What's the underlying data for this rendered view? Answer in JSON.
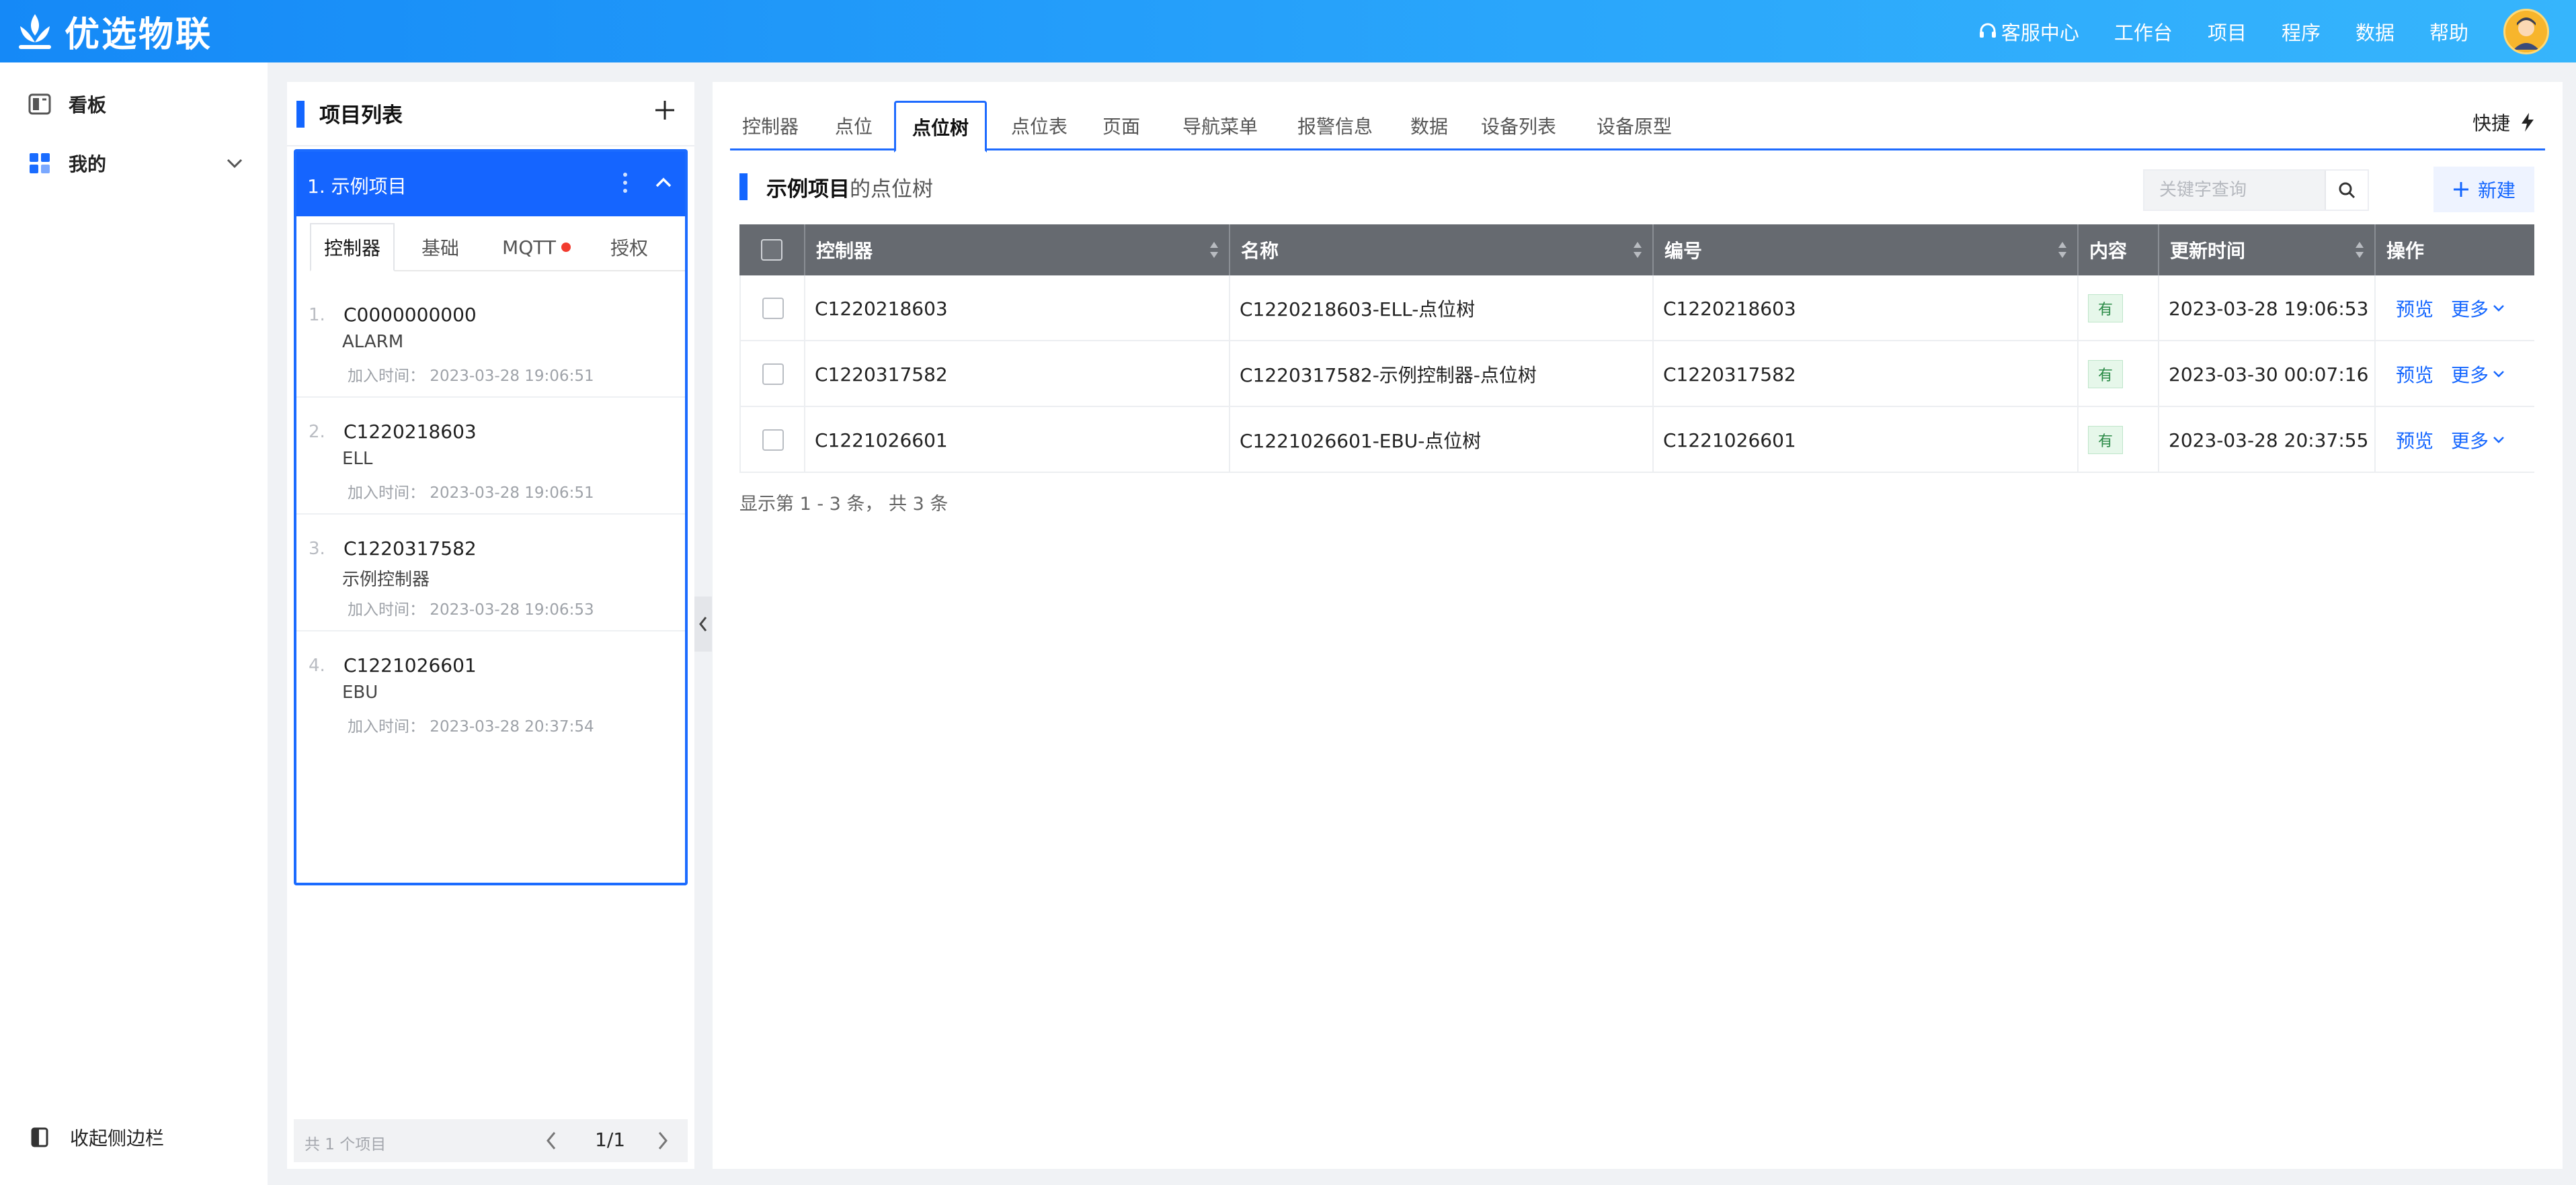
{
  "header": {
    "brand": "优选物联",
    "nav": [
      "客服中心",
      "工作台",
      "项目",
      "程序",
      "数据",
      "帮助"
    ]
  },
  "sidebar": {
    "items": [
      {
        "label": "看板",
        "icon": "dashboard-icon"
      },
      {
        "label": "我的",
        "icon": "grid-icon"
      }
    ],
    "collapse_label": "收起侧边栏"
  },
  "project_panel": {
    "title": "项目列表",
    "selected": "1. 示例项目",
    "tabs": [
      "控制器",
      "基础",
      "MQTT",
      "授权"
    ],
    "controllers": [
      {
        "index": "1.",
        "code": "C0000000000",
        "desc": "ALARM",
        "joined": "加入时间： 2023-03-28 19:06:51"
      },
      {
        "index": "2.",
        "code": "C1220218603",
        "desc": "ELL",
        "joined": "加入时间： 2023-03-28 19:06:51"
      },
      {
        "index": "3.",
        "code": "C1220317582",
        "desc": "示例控制器",
        "joined": "加入时间： 2023-03-28 19:06:53"
      },
      {
        "index": "4.",
        "code": "C1221026601",
        "desc": "EBU",
        "joined": "加入时间： 2023-03-28 20:37:54"
      }
    ],
    "footer_count": "共 1 个项目",
    "page": "1/1"
  },
  "main": {
    "tabs": [
      "控制器",
      "点位",
      "点位树",
      "点位表",
      "页面",
      "导航菜单",
      "报警信息",
      "数据",
      "设备列表",
      "设备原型"
    ],
    "active_tab": "点位树",
    "quick": "快捷",
    "section_title_strong": "示例项目",
    "section_title_light": "的点位树",
    "search_placeholder": "关键字查询",
    "new_label": "新建",
    "table": {
      "columns": [
        "控制器",
        "名称",
        "编号",
        "内容",
        "更新时间",
        "操作"
      ],
      "rows": [
        {
          "controller": "C1220218603",
          "name": "C1220218603-ELL-点位树",
          "code": "C1220218603",
          "content": "有",
          "updated": "2023-03-28 19:06:53",
          "preview": "预览",
          "more": "更多"
        },
        {
          "controller": "C1220317582",
          "name": "C1220317582-示例控制器-点位树",
          "code": "C1220317582",
          "content": "有",
          "updated": "2023-03-30 00:07:16",
          "preview": "预览",
          "more": "更多"
        },
        {
          "controller": "C1221026601",
          "name": "C1221026601-EBU-点位树",
          "code": "C1221026601",
          "content": "有",
          "updated": "2023-03-28 20:37:55",
          "preview": "预览",
          "more": "更多"
        }
      ]
    },
    "summary": "显示第 1 - 3 条， 共 3 条"
  }
}
